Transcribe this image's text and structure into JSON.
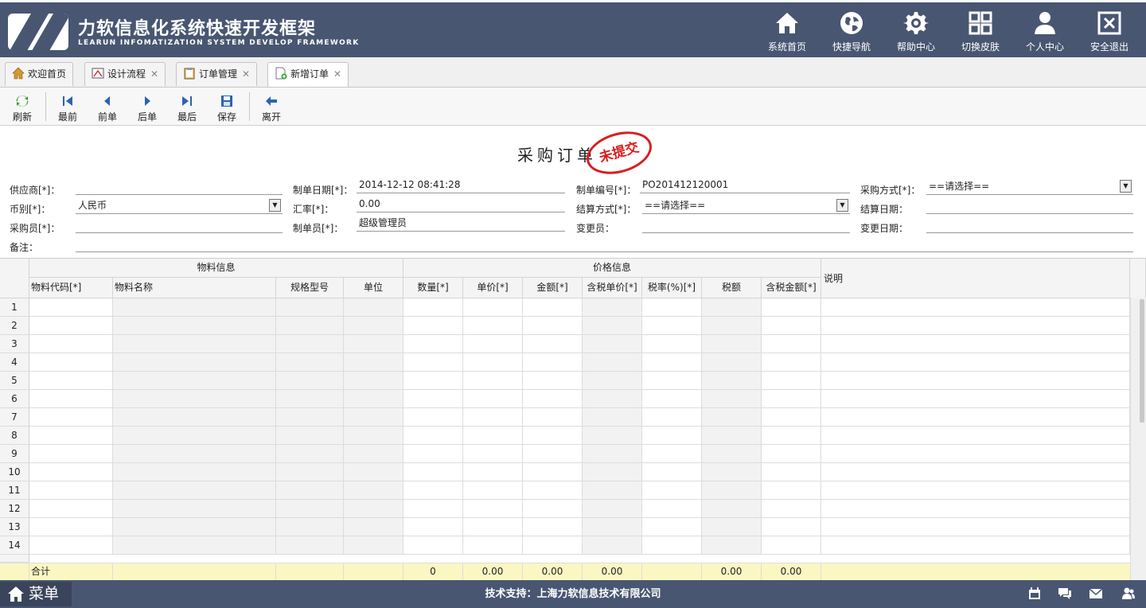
{
  "header": {
    "title": "力软信息化系统快速开发框架",
    "subtitle": "LEARUN INFOMATIZATION SYSTEM DEVELOP FRAMEWORK",
    "nav": [
      {
        "label": "系统首页",
        "icon": "home-icon"
      },
      {
        "label": "快捷导航",
        "icon": "globe-icon"
      },
      {
        "label": "帮助中心",
        "icon": "gear-icon"
      },
      {
        "label": "切换皮肤",
        "icon": "grid-icon"
      },
      {
        "label": "个人中心",
        "icon": "user-icon"
      },
      {
        "label": "安全退出",
        "icon": "exit-icon"
      }
    ]
  },
  "tabs": [
    {
      "label": "欢迎首页",
      "icon": "home-icon",
      "closable": false
    },
    {
      "label": "设计流程",
      "icon": "design-icon",
      "closable": true
    },
    {
      "label": "订单管理",
      "icon": "clipboard-icon",
      "closable": true
    },
    {
      "label": "新增订单",
      "icon": "new-doc-icon",
      "closable": true,
      "active": true
    }
  ],
  "toolbar": {
    "refresh": "刷新",
    "first": "最前",
    "prev": "前单",
    "next": "后单",
    "last": "最后",
    "save": "保存",
    "leave": "离开"
  },
  "form": {
    "title": "采购订单",
    "stamp": "未提交",
    "fields": {
      "supplier_label": "供应商[*]：",
      "supplier_value": "",
      "date_label": "制单日期[*]：",
      "date_value": "2014-12-12 08:41:28",
      "number_label": "制单编号[*]：",
      "number_value": "PO201412120001",
      "method_label": "采购方式[*]：",
      "method_value": "==请选择==",
      "currency_label": "币别[*]：",
      "currency_value": "人民币",
      "rate_label": "汇率[*]：",
      "rate_value": "0.00",
      "settle_label": "结算方式[*]：",
      "settle_value": "==请选择==",
      "settle_date_label": "结算日期：",
      "settle_date_value": "",
      "buyer_label": "采购员[*]：",
      "buyer_value": "",
      "creator_label": "制单员[*]：",
      "creator_value": "超级管理员",
      "changer_label": "变更员：",
      "changer_value": "",
      "change_date_label": "变更日期：",
      "change_date_value": "",
      "remark_label": "备注：",
      "remark_value": ""
    }
  },
  "grid": {
    "group_material": "物料信息",
    "group_price": "价格信息",
    "columns": [
      "物料代码[*]",
      "物料名称",
      "规格型号",
      "单位",
      "数量[*]",
      "单价[*]",
      "金额[*]",
      "含税单价[*]",
      "税率(%)[*]",
      "税额",
      "含税金额[*]",
      "说明"
    ],
    "row_numbers": [
      "1",
      "2",
      "3",
      "4",
      "5",
      "6",
      "7",
      "8",
      "9",
      "10",
      "11",
      "12",
      "13",
      "14"
    ],
    "totals": {
      "label": "合计",
      "quantity": "0",
      "unit_price": "0.00",
      "amount": "0.00",
      "tax_unit_price": "0.00",
      "tax": "0.00",
      "tax_amount": "0.00"
    }
  },
  "footer": {
    "menu": "菜单",
    "support": "技术支持：上海力软信息技术有限公司"
  },
  "colors": {
    "header_bg": "#485672",
    "totals_bg": "#fbf7c2",
    "stamp": "#d81e1e"
  }
}
